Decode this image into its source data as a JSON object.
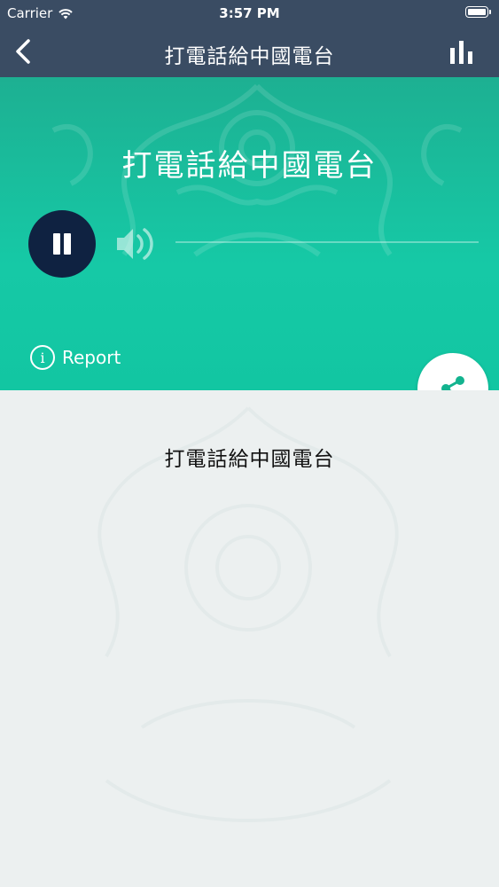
{
  "status_bar": {
    "carrier": "Carrier",
    "time": "3:57 PM"
  },
  "nav": {
    "title": "打電話給中國電台",
    "back_icon": "chevron-left-icon",
    "equalizer_icon": "bar-chart-icon"
  },
  "player": {
    "station_name": "打電話給中國電台",
    "state": "playing",
    "report_label": "Report",
    "volume_level": 0.0
  },
  "content": {
    "description": "打電話給中國電台"
  },
  "colors": {
    "nav_bg": "#3a4c63",
    "hero_green": "#16c9a6",
    "pause_button": "#0f2241",
    "share_icon": "#13b38f"
  }
}
